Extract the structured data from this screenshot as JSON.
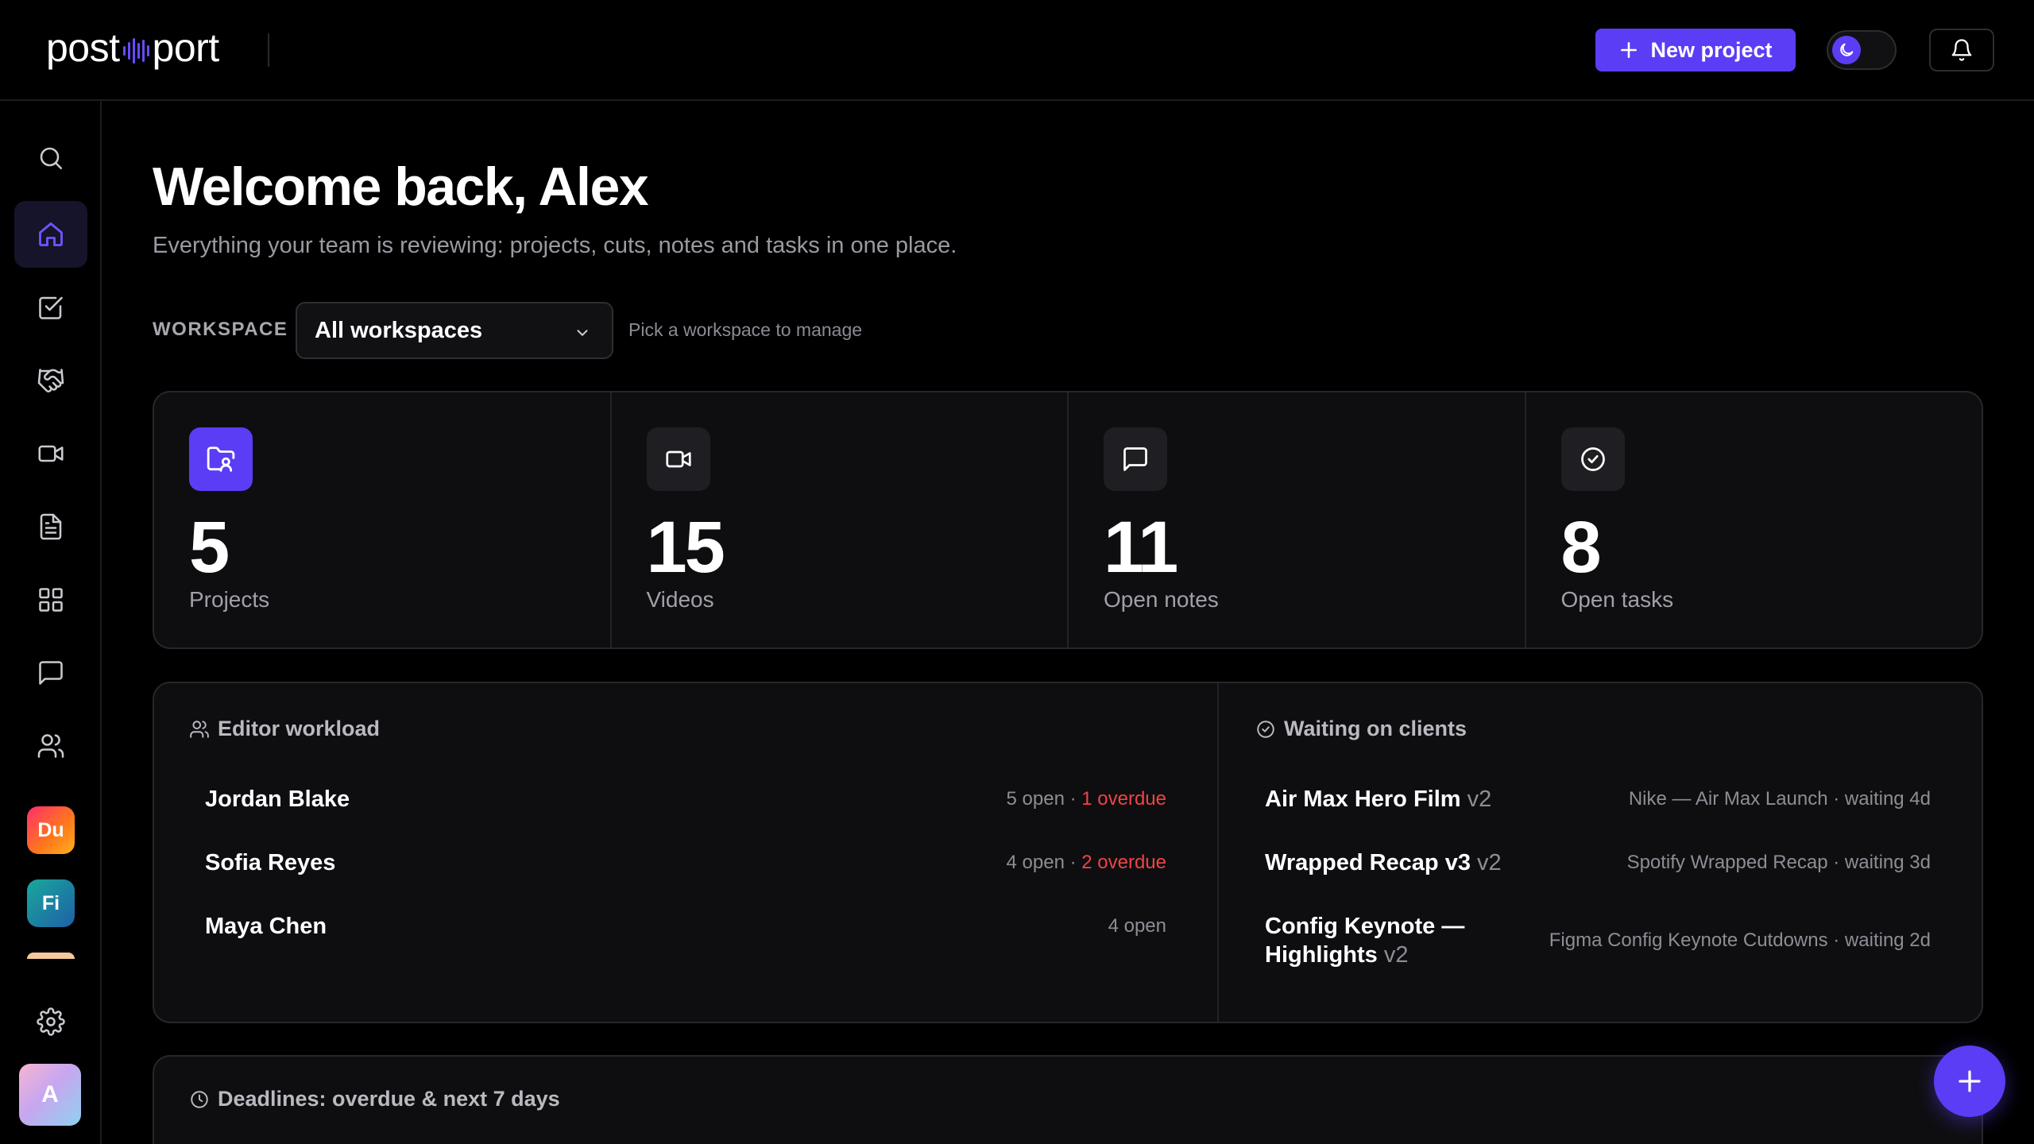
{
  "brand": {
    "left": "post",
    "right": "port"
  },
  "topbar": {
    "new_project_label": "New project"
  },
  "sidebar": {
    "items": [
      {
        "name": "search",
        "icon": "search-icon"
      },
      {
        "name": "home",
        "icon": "home-icon",
        "active": true
      },
      {
        "name": "tasks",
        "icon": "checkbox-icon"
      },
      {
        "name": "clients",
        "icon": "handshake-icon"
      },
      {
        "name": "videos",
        "icon": "video-icon"
      },
      {
        "name": "documents",
        "icon": "document-icon"
      },
      {
        "name": "apps",
        "icon": "grid-icon"
      },
      {
        "name": "messages",
        "icon": "chat-icon"
      },
      {
        "name": "team",
        "icon": "users-icon"
      }
    ],
    "apps": [
      {
        "label": "Du"
      },
      {
        "label": "Fi"
      }
    ],
    "settings_icon": "gear-icon",
    "avatar_label": "A"
  },
  "welcome": {
    "title": "Welcome back, Alex",
    "subtitle": "Everything your team is reviewing: projects, cuts, notes and tasks in one place."
  },
  "workspace": {
    "label": "WORKSPACE",
    "selected": "All workspaces",
    "hint": "Pick a workspace to manage"
  },
  "stats": [
    {
      "value": "5",
      "label": "Projects",
      "icon": "folder-user-icon",
      "highlight": true
    },
    {
      "value": "15",
      "label": "Videos",
      "icon": "video-icon"
    },
    {
      "value": "11",
      "label": "Open notes",
      "icon": "chat-icon"
    },
    {
      "value": "8",
      "label": "Open tasks",
      "icon": "check-circle-icon"
    }
  ],
  "workload": {
    "title": "Editor workload",
    "rows": [
      {
        "name": "Jordan Blake",
        "open": "5 open",
        "sep": " · ",
        "overdue": "1 overdue"
      },
      {
        "name": "Sofia Reyes",
        "open": "4 open",
        "sep": " · ",
        "overdue": "2 overdue"
      },
      {
        "name": "Maya Chen",
        "open": "4 open",
        "sep": "",
        "overdue": ""
      }
    ]
  },
  "clients": {
    "title": "Waiting on clients",
    "rows": [
      {
        "title": "Air Max Hero Film",
        "version": "v2",
        "meta": "Nike — Air Max Launch · waiting 4d"
      },
      {
        "title": "Wrapped Recap v3",
        "version": "v2",
        "meta": "Spotify Wrapped Recap · waiting 3d"
      },
      {
        "title_line1": "Config Keynote —",
        "title_line2": "Highlights",
        "version": "v2",
        "meta": "Figma Config Keynote Cutdowns · waiting 2d"
      }
    ]
  },
  "deadlines": {
    "title": "Deadlines: overdue & next 7 days"
  },
  "colors": {
    "accent": "#5b3df5",
    "overdue": "#ef4444",
    "background": "#000000",
    "panel": "#0e0e11"
  }
}
